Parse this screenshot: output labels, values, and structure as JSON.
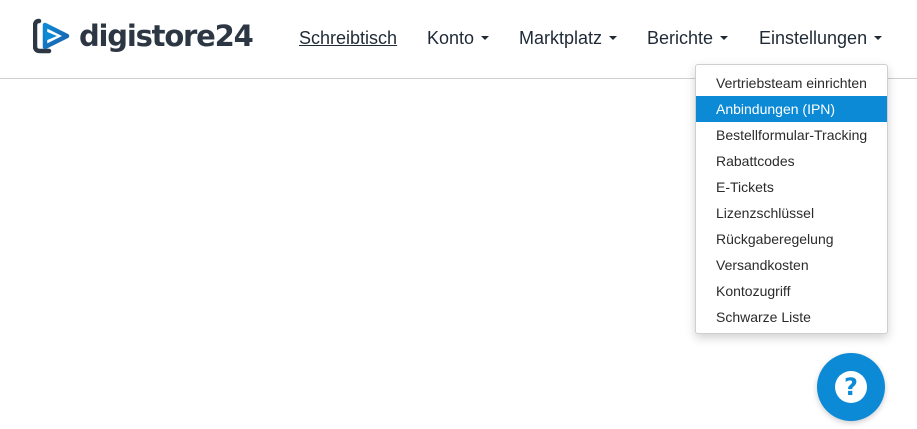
{
  "brand": {
    "name": "digistore24",
    "colors": {
      "primary": "#0c8ad6",
      "text": "#2d3744"
    }
  },
  "nav": {
    "items": [
      {
        "label": "Schreibtisch"
      },
      {
        "label": "Konto"
      },
      {
        "label": "Marktplatz"
      },
      {
        "label": "Berichte"
      },
      {
        "label": "Einstellungen"
      }
    ]
  },
  "dropdown": {
    "items": [
      {
        "label": "Vertriebsteam einrichten"
      },
      {
        "label": "Anbindungen (IPN)"
      },
      {
        "label": "Bestellformular-Tracking"
      },
      {
        "label": "Rabattcodes"
      },
      {
        "label": "E-Tickets"
      },
      {
        "label": "Lizenzschlüssel"
      },
      {
        "label": "Rückgaberegelung"
      },
      {
        "label": "Versandkosten"
      },
      {
        "label": "Kontozugriff"
      },
      {
        "label": "Schwarze Liste"
      }
    ],
    "active_color": "#0c8ad6"
  },
  "help": {
    "icon": "question-mark-icon",
    "glyph": "?"
  }
}
